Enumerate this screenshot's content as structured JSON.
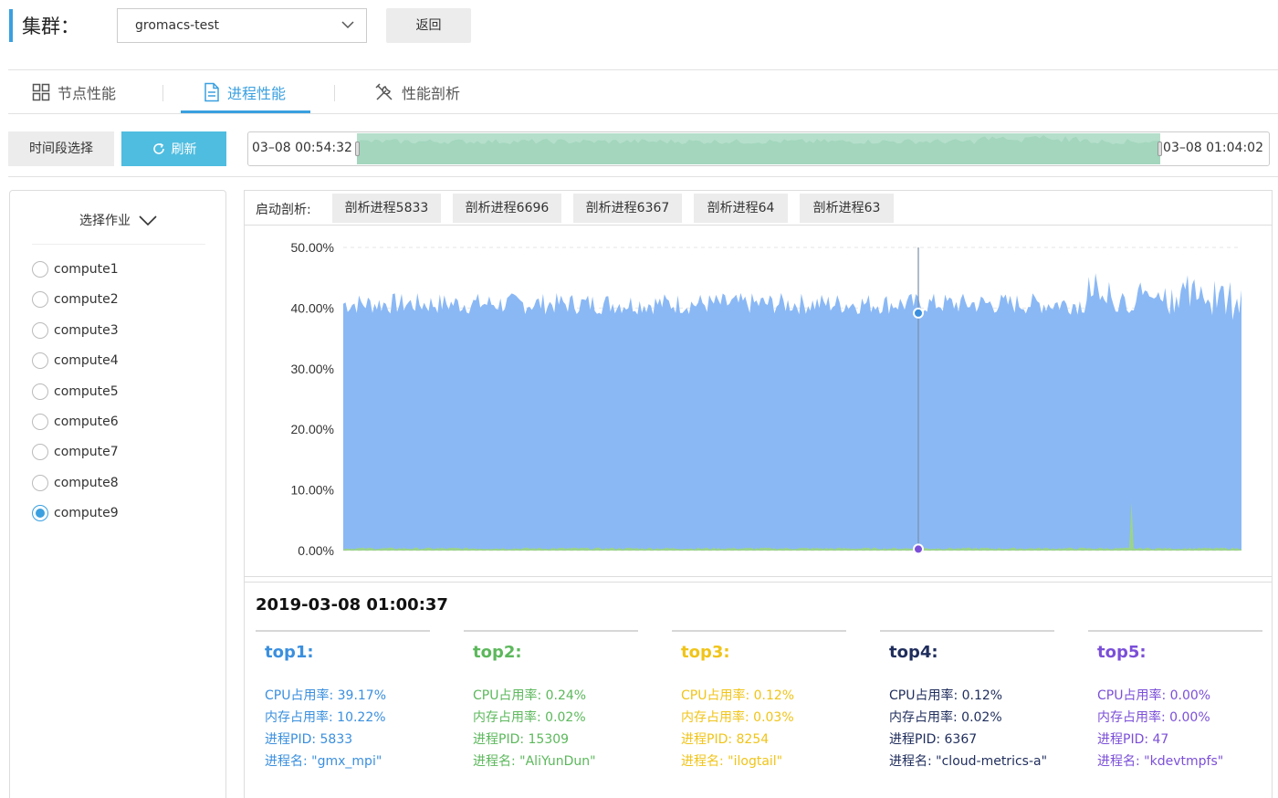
{
  "header": {
    "title": "集群：",
    "cluster_value": "gromacs-test",
    "back_label": "返回"
  },
  "tabs": [
    {
      "label": "节点性能",
      "icon": "grid-icon"
    },
    {
      "label": "进程性能",
      "icon": "document-icon",
      "active": true
    },
    {
      "label": "性能剖析",
      "icon": "tools-icon"
    }
  ],
  "toolbar": {
    "time_select_label": "时间段选择",
    "refresh_label": "刷新",
    "range_start": "03–08 00:54:32",
    "range_end": "03–08 01:04:02"
  },
  "jobs": {
    "header_label": "选择作业",
    "items": [
      "compute1",
      "compute2",
      "compute3",
      "compute4",
      "compute5",
      "compute6",
      "compute7",
      "compute8",
      "compute9"
    ],
    "selected": "compute9"
  },
  "profiling": {
    "label": "启动剖析:",
    "buttons": [
      "剖析进程5833",
      "剖析进程6696",
      "剖析进程6367",
      "剖析进程64",
      "剖析进程63"
    ]
  },
  "chart_data": {
    "type": "area",
    "ylim": [
      0,
      50
    ],
    "yticks": [
      "0.00%",
      "10.00%",
      "20.00%",
      "30.00%",
      "40.00%",
      "50.00%"
    ],
    "series": [
      {
        "color": "#8ab8f5",
        "typical_value": 40
      },
      {
        "color": "#9bd48a",
        "typical_value": 0.2
      }
    ],
    "cursor": {
      "value_top1": 39.17,
      "value_top2": 0.24
    }
  },
  "detail": {
    "timestamp": "2019-03-08 01:00:37",
    "tops": [
      {
        "name": "top1:",
        "color": "#3a8fde",
        "cpu": "CPU占用率: 39.17%",
        "mem": "内存占用率: 10.22%",
        "pid": "进程PID: 5833",
        "pname": "进程名: \"gmx_mpi\""
      },
      {
        "name": "top2:",
        "color": "#5cb85c",
        "cpu": "CPU占用率: 0.24%",
        "mem": "内存占用率: 0.02%",
        "pid": "进程PID: 15309",
        "pname": "进程名: \"AliYunDun\""
      },
      {
        "name": "top3:",
        "color": "#f0c419",
        "cpu": "CPU占用率: 0.12%",
        "mem": "内存占用率: 0.03%",
        "pid": "进程PID: 8254",
        "pname": "进程名: \"ilogtail\""
      },
      {
        "name": "top4:",
        "color": "#1f2d5c",
        "cpu": "CPU占用率: 0.12%",
        "mem": "内存占用率: 0.02%",
        "pid": "进程PID: 6367",
        "pname": "进程名: \"cloud-metrics-a\""
      },
      {
        "name": "top5:",
        "color": "#7b4fd8",
        "cpu": "CPU占用率: 0.00%",
        "mem": "内存占用率: 0.00%",
        "pid": "进程PID: 47",
        "pname": "进程名: \"kdevtmpfs\""
      }
    ]
  }
}
